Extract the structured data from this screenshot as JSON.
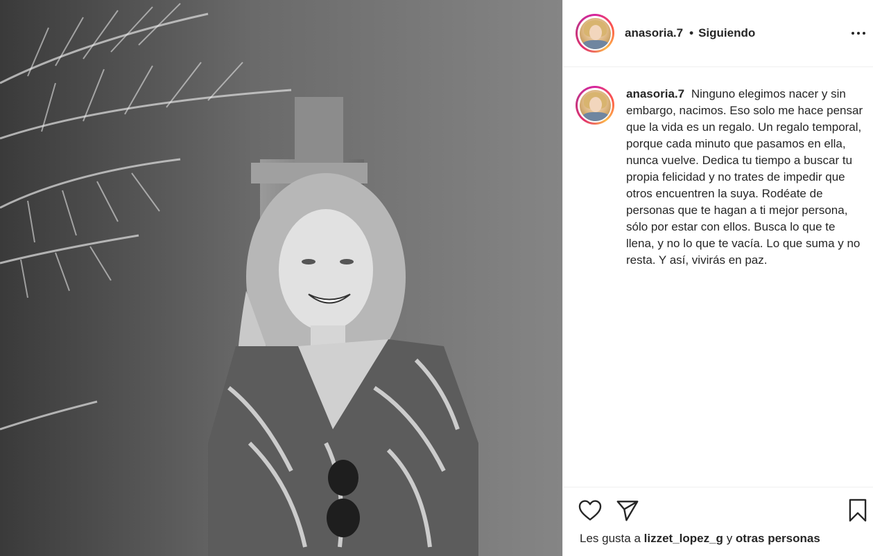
{
  "post": {
    "username": "anasoria.7",
    "follow_separator": "•",
    "follow_status": "Siguiendo",
    "caption": "Ninguno elegimos nacer y sin embargo, nacimos. Eso solo me hace pensar que la vida es un regalo. Un regalo temporal, porque cada minuto que pasamos en ella, nunca vuelve. Dedica tu tiempo a buscar tu propia felicidad y no trates de impedir que otros encuentren la suya. Rodéate de personas que te hagan a ti mejor persona, sólo por estar con ellos. Busca lo que te llena, y no lo que te vacía. Lo que suma y no resta. Y así, vivirás en paz.",
    "likes": {
      "prefix": "Les gusta a",
      "liked_by": "lizzet_lopez_g",
      "connector": "y",
      "others": "otras personas"
    }
  },
  "icons": {
    "more": "more-options-icon",
    "like": "heart-icon",
    "share": "paper-plane-icon",
    "save": "bookmark-icon"
  },
  "colors": {
    "story_ring": "#d6249f",
    "text": "#262626",
    "divider": "#efefef"
  }
}
